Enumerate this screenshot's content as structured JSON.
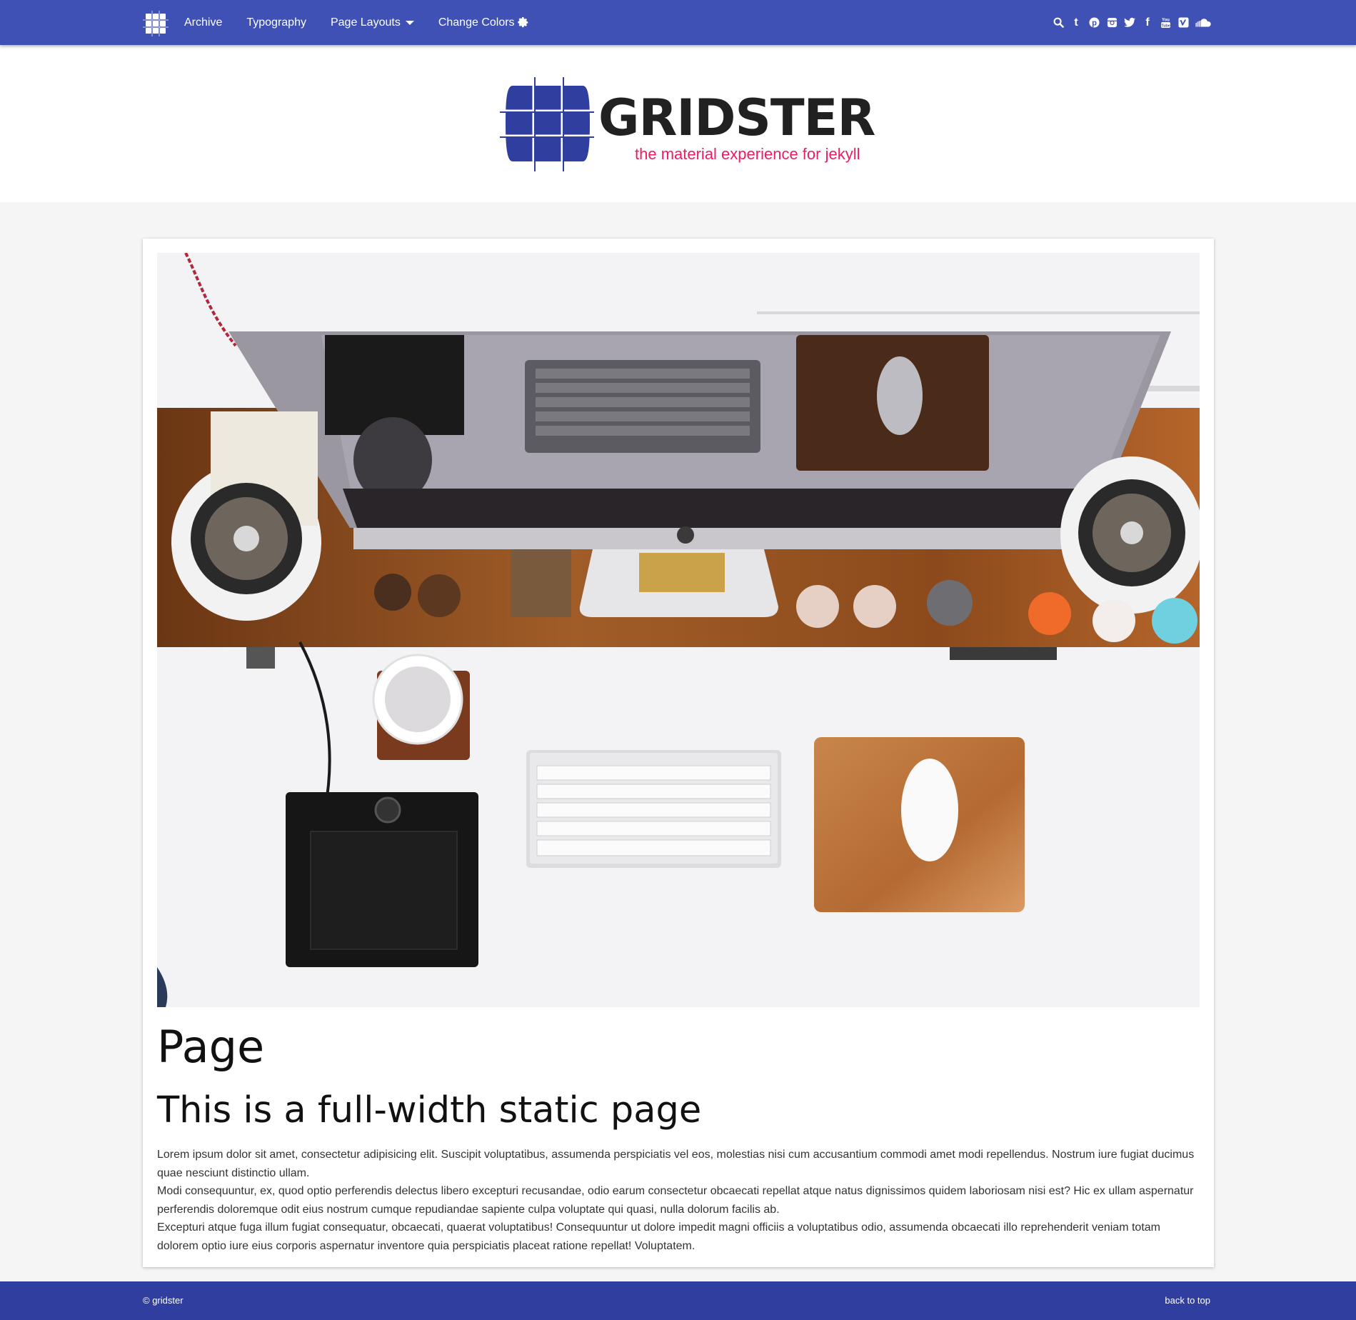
{
  "nav": {
    "logo_icon": "grid-icon",
    "links": [
      {
        "label": "Archive"
      },
      {
        "label": "Typography"
      },
      {
        "label": "Page Layouts",
        "icon": "caret-down-icon"
      },
      {
        "label": "Change Colors",
        "icon": "gear-icon"
      }
    ],
    "social": [
      {
        "icon": "search-icon",
        "glyph": ""
      },
      {
        "icon": "tumblr-icon",
        "glyph": "t"
      },
      {
        "icon": "pinterest-icon",
        "glyph": ""
      },
      {
        "icon": "instagram-icon",
        "glyph": ""
      },
      {
        "icon": "twitter-icon",
        "glyph": ""
      },
      {
        "icon": "facebook-icon",
        "glyph": "f"
      },
      {
        "icon": "youtube-icon",
        "glyph": ""
      },
      {
        "icon": "vimeo-icon",
        "glyph": "V"
      },
      {
        "icon": "soundcloud-icon",
        "glyph": ""
      }
    ]
  },
  "brand": {
    "name": "GRIDSTER",
    "tagline": "the material experience for jekyll"
  },
  "page": {
    "title": "Page",
    "subtitle": "This is a full-width static page",
    "paragraphs": [
      "Lorem ipsum dolor sit amet, consectetur adipisicing elit. Suscipit voluptatibus, assumenda perspiciatis vel eos, molestias nisi cum accusantium commodi amet modi repellendus. Nostrum iure fugiat ducimus quae nesciunt distinctio ullam.",
      "Modi consequuntur, ex, quod optio perferendis delectus libero excepturi recusandae, odio earum consectetur obcaecati repellat atque natus dignissimos quidem laboriosam nisi est? Hic ex ullam aspernatur perferendis doloremque odit eius nostrum cumque repudiandae sapiente culpa voluptate qui quasi, nulla dolorum facilis ab.",
      "Excepturi atque fuga illum fugiat consequatur, obcaecati, quaerat voluptatibus! Consequuntur ut dolore impedit magni officiis a voluptatibus odio, assumenda obcaecati illo reprehenderit veniam totam dolorem optio iure eius corporis aspernatur inventore quia perspiciatis placeat ratione repellat! Voluptatem."
    ]
  },
  "footer": {
    "copyright": "© gridster",
    "back_to_top": "back to top"
  },
  "colors": {
    "primary": "#3f51b5",
    "primary_dark": "#303f9f",
    "accent": "#e91e63",
    "brand_mark": "#303f9f"
  }
}
